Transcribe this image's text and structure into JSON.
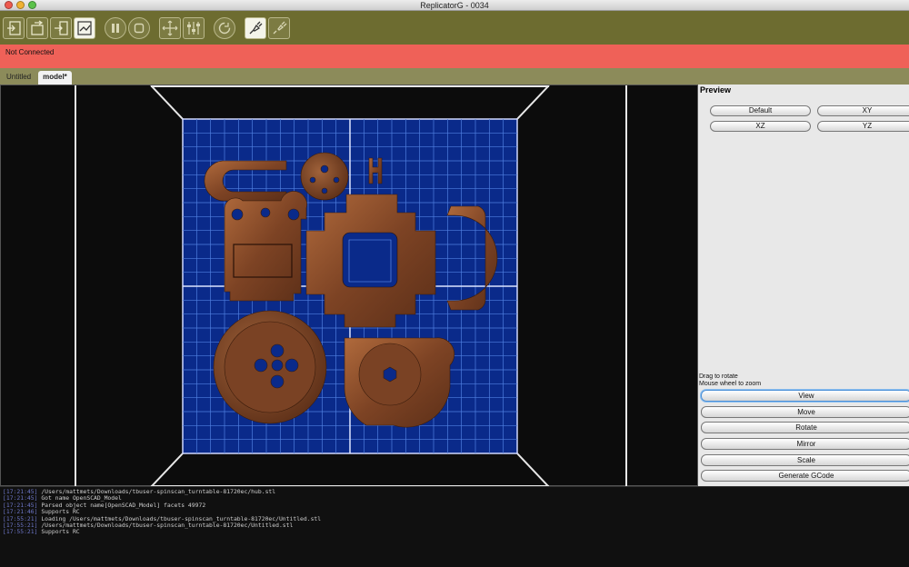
{
  "window": {
    "title": "ReplicatorG - 0034",
    "traffic_lights": [
      "#ee5a4f",
      "#f0b232",
      "#5bc24a"
    ]
  },
  "toolbar": {
    "buttons": [
      {
        "name": "build-from-sd-icon"
      },
      {
        "name": "upload-to-sd-icon"
      },
      {
        "name": "build-to-file-icon"
      },
      {
        "name": "build-icon",
        "active": true
      },
      {
        "name": "pause-icon"
      },
      {
        "name": "stop-icon"
      },
      {
        "name": "control-panel-icon"
      },
      {
        "name": "sliders-icon"
      },
      {
        "name": "reset-icon"
      },
      {
        "name": "connect-icon",
        "active": true
      },
      {
        "name": "disconnect-icon"
      }
    ],
    "background": "#6d6c30"
  },
  "status": {
    "text": "Not Connected",
    "color": "#ef6158"
  },
  "tabs": [
    {
      "label": "Untitled"
    },
    {
      "label": "model*"
    }
  ],
  "preview": {
    "heading": "Preview",
    "buttons": {
      "default": "Default",
      "xy": "XY",
      "xz": "XZ",
      "yz": "YZ"
    },
    "hint_rotate": "Drag to rotate",
    "hint_zoom": "Mouse wheel to zoom"
  },
  "actions": {
    "view": "View",
    "move": "Move",
    "rotate": "Rotate",
    "mirror": "Mirror",
    "scale": "Scale",
    "generate": "Generate GCode"
  },
  "console": {
    "lines": [
      {
        "ts": "[17:21:45]",
        "msg": " /Users/mattmets/Downloads/tbuser-spinscan_turntable-81720ec/hub.stl"
      },
      {
        "ts": "[17:21:45]",
        "msg": " Got name OpenSCAD_Model"
      },
      {
        "ts": "[17:21:45]",
        "msg": " Parsed object name[OpenSCAD_Model] facets 49972"
      },
      {
        "ts": "[17:21:46]",
        "msg": " Supports RC"
      },
      {
        "ts": "[17:55:21]",
        "msg": " Loading /Users/mattmets/Downloads/tbuser-spinscan_turntable-81720ec/Untitled.stl"
      },
      {
        "ts": "[17:55:21]",
        "msg": " /Users/mattmets/Downloads/tbuser-spinscan_turntable-81720ec/Untitled.stl"
      },
      {
        "ts": "[17:55:21]",
        "msg": " Supports RC"
      }
    ]
  },
  "colors": {
    "grid_bg": "#0a2a8a",
    "grid_line": "#4f7fe0",
    "part": "#8a4a28"
  }
}
